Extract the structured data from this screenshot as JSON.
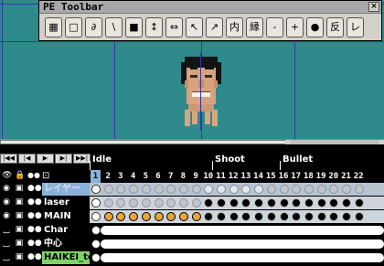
{
  "toolbar": {
    "title": "PE Toolbar",
    "close_label": "×",
    "buttons": [
      {
        "label": "▦",
        "icon": "grid-icon"
      },
      {
        "label": "□",
        "icon": "rect-select-icon"
      },
      {
        "label": "∂",
        "icon": "lasso-icon"
      },
      {
        "label": "\\",
        "icon": "pen-icon"
      },
      {
        "label": "■",
        "icon": "fill-icon"
      },
      {
        "label": "↕",
        "icon": "flip-vertical-icon"
      },
      {
        "label": "⇔",
        "icon": "flip-horizontal-icon"
      },
      {
        "label": "↖",
        "icon": "arrow-upleft-icon"
      },
      {
        "label": "↗",
        "icon": "arrow-upright-icon"
      },
      {
        "label": "内",
        "icon": "inner-icon"
      },
      {
        "label": "縁",
        "icon": "edge-icon"
      },
      {
        "label": "-",
        "icon": "minus-icon"
      },
      {
        "label": "+",
        "icon": "plus-icon"
      },
      {
        "label": "●",
        "icon": "dot-icon"
      },
      {
        "label": "反",
        "icon": "invert-icon"
      },
      {
        "label": "レ",
        "icon": "check-icon"
      }
    ]
  },
  "transport": [
    "|◀◀",
    "|◀",
    "▶",
    "▶|",
    "▶▶|"
  ],
  "labels": [
    {
      "text": "Idle",
      "frame": 1
    },
    {
      "text": "Shoot",
      "frame": 10
    },
    {
      "text": "Bullet",
      "frame": 15
    }
  ],
  "frames": [
    "1",
    "2",
    "3",
    "4",
    "5",
    "6",
    "7",
    "8",
    "9",
    "10",
    "11",
    "12",
    "13",
    "14",
    "15",
    "16",
    "17",
    "18",
    "19",
    "20",
    "21",
    "22"
  ],
  "active_frame": "1",
  "header_icons": {
    "eye": "👁",
    "lock": "🔒",
    "dots": "●●",
    "sep": "⊡"
  },
  "layers": [
    {
      "name": "レイヤー",
      "style": "sel"
    },
    {
      "name": "laser",
      "style": ""
    },
    {
      "name": "MAIN",
      "style": ""
    },
    {
      "name": "Char",
      "style": ""
    },
    {
      "name": "中心",
      "style": ""
    },
    {
      "name": "HAIKEI_te",
      "style": "green"
    }
  ],
  "colors": {
    "canvas": "#2f8a8c",
    "guide": "#3436a8",
    "selected_layer": "#8ab2d8",
    "orange_key": "#e8a43a",
    "green_layer": "#7fd36a"
  }
}
